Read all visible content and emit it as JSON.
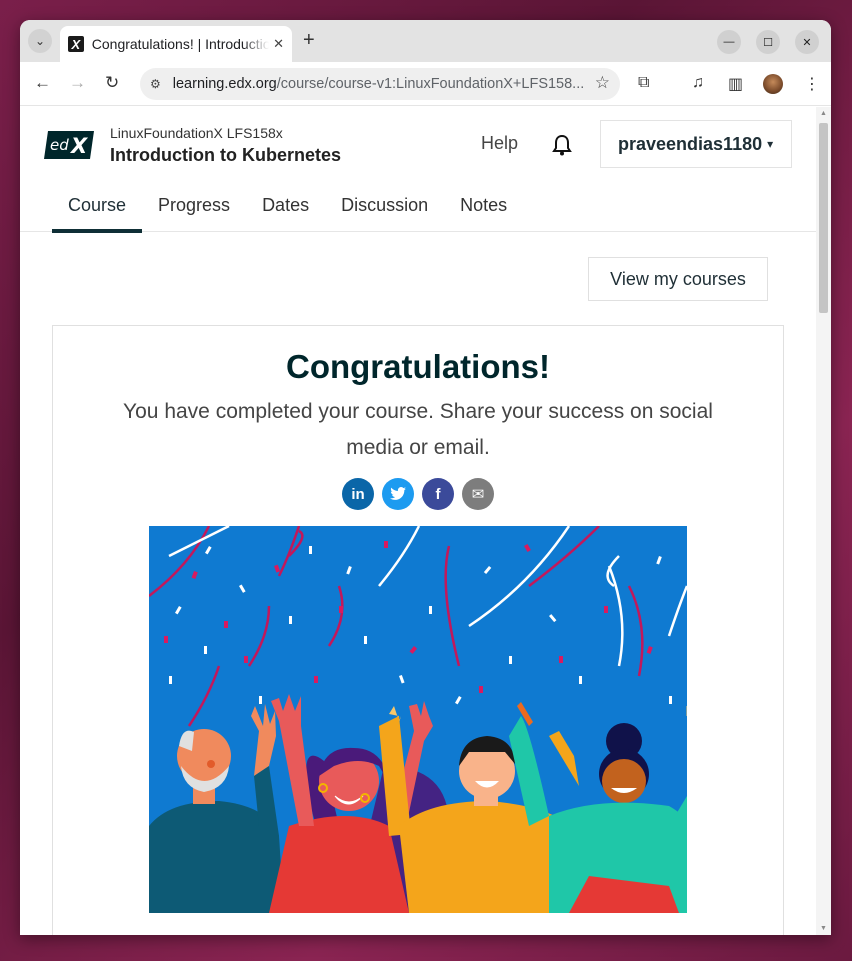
{
  "browser": {
    "tab_title": "Congratulations! | Introduction to Kubernetes",
    "tab_favicon": "X",
    "url_domain": "learning.edx.org",
    "url_path": "/course/course-v1:LinuxFoundationX+LFS158..."
  },
  "header": {
    "org": "LinuxFoundationX LFS158x",
    "course_title": "Introduction to Kubernetes",
    "help_label": "Help",
    "username": "praveendias1180"
  },
  "nav": {
    "tabs": [
      "Course",
      "Progress",
      "Dates",
      "Discussion",
      "Notes"
    ],
    "active": "Course"
  },
  "main": {
    "view_courses_label": "View my courses",
    "congrats_title": "Congratulations!",
    "congrats_text": "You have completed your course. Share your success on social media or email.",
    "share_buttons": [
      {
        "name": "linkedin-icon",
        "glyph": "in",
        "color": "#0a66a8"
      },
      {
        "name": "twitter-icon",
        "glyph": "🐦",
        "color": "#1d9bf0"
      },
      {
        "name": "facebook-icon",
        "glyph": "f",
        "color": "#3b4a9a"
      },
      {
        "name": "email-icon",
        "glyph": "✉",
        "color": "#7d7d7d"
      }
    ]
  },
  "colors": {
    "brand_dark": "#00262b",
    "illustration_bg": "#0f7ad1"
  }
}
